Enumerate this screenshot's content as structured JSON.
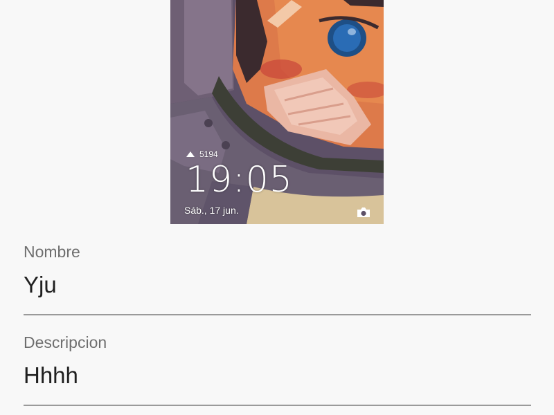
{
  "preview": {
    "status_text": "5194",
    "time": "19:05",
    "date": "Sáb., 17 jun."
  },
  "form": {
    "name_label": "Nombre",
    "name_value": "Yju",
    "description_label": "Descripcion",
    "description_value": "Hhhh"
  },
  "colors": {
    "label": "#6e6e6e",
    "value": "#1f1f1f",
    "underline": "#9a9a9a",
    "background": "#f8f8f8"
  },
  "icons": [
    "signal-icon",
    "camera-icon"
  ]
}
